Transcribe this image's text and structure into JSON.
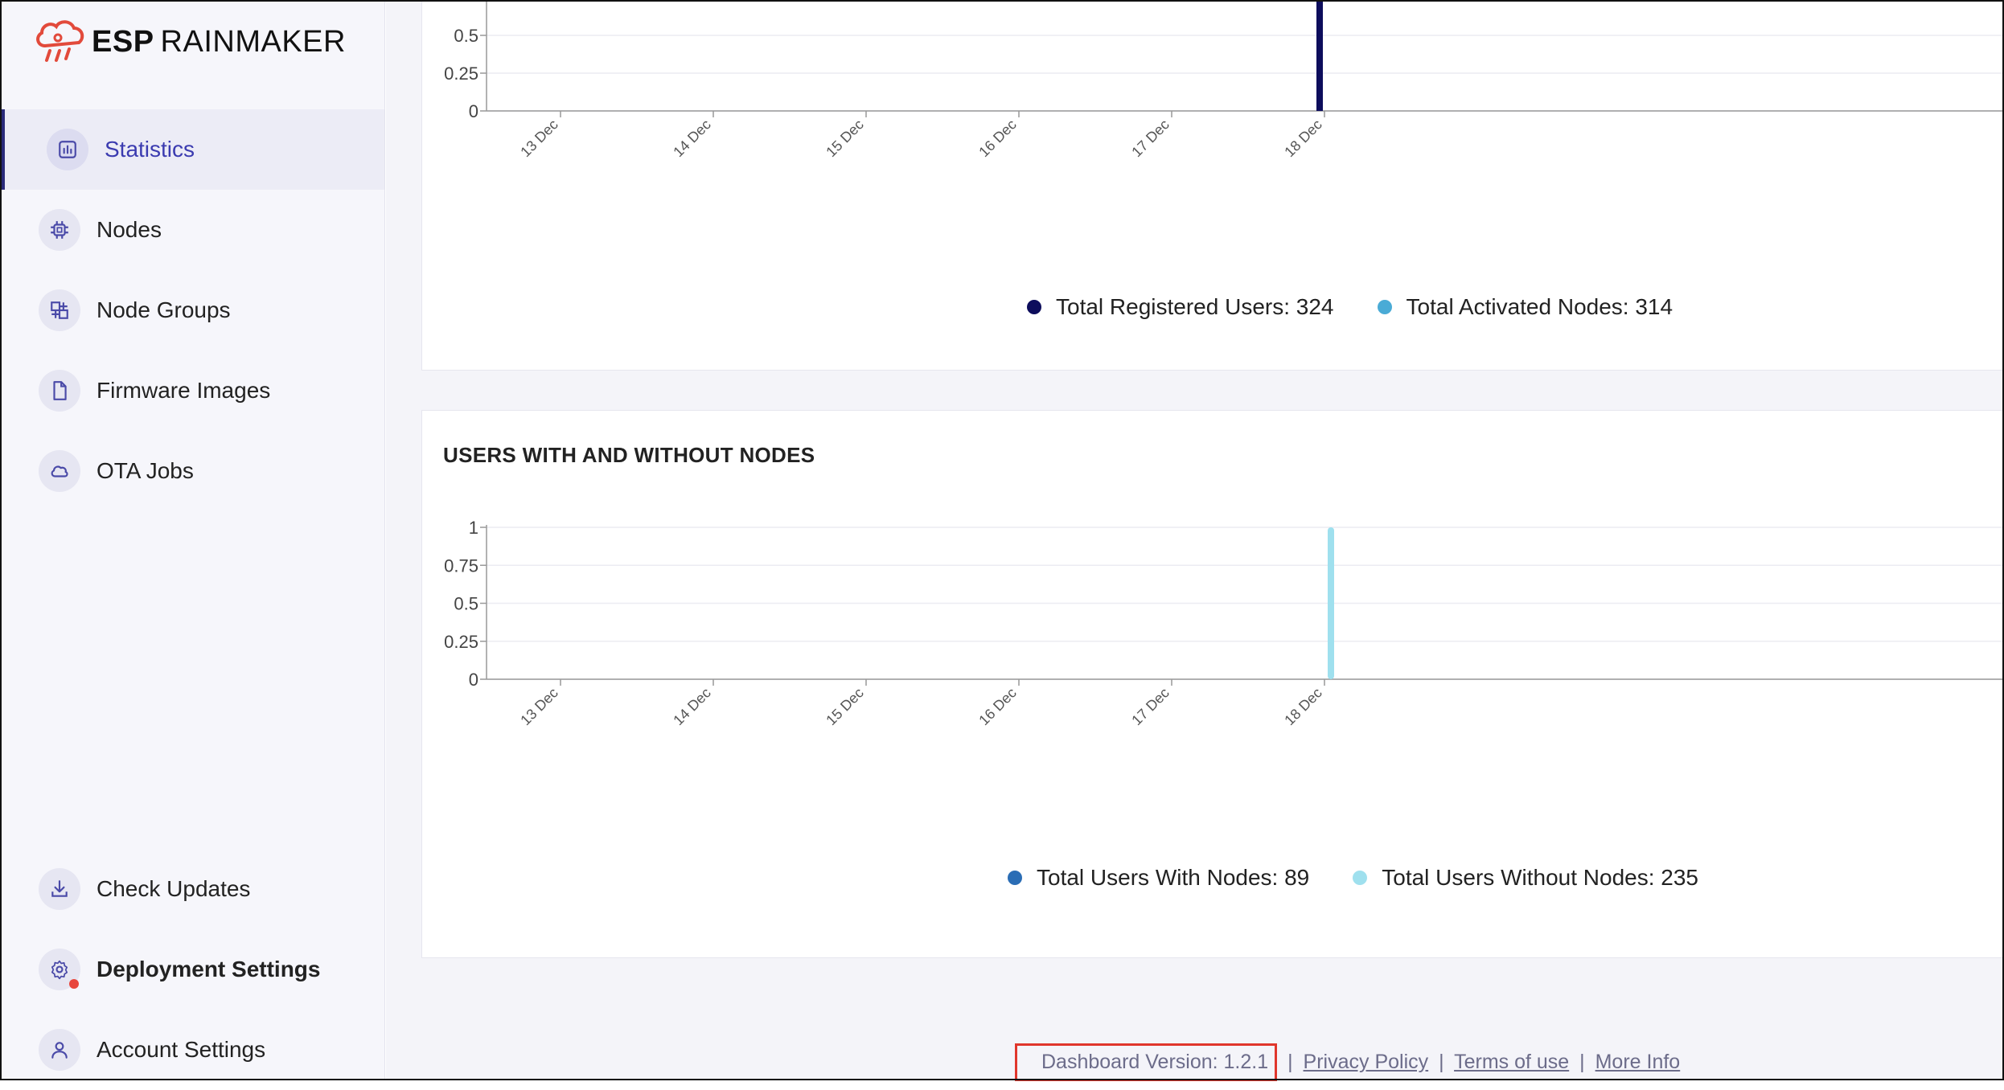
{
  "brand": {
    "esp": "ESP",
    "rainmaker": "RAINMAKER",
    "logo_color": "#e24a3b"
  },
  "sidebar": {
    "items": [
      {
        "label": "Statistics",
        "icon": "bar-chart-icon",
        "active": true
      },
      {
        "label": "Nodes",
        "icon": "chip-icon"
      },
      {
        "label": "Node Groups",
        "icon": "node-groups-icon"
      },
      {
        "label": "Firmware Images",
        "icon": "file-icon"
      },
      {
        "label": "OTA Jobs",
        "icon": "cloud-icon"
      }
    ],
    "bottom_items": [
      {
        "label": "Check Updates",
        "icon": "download-icon"
      },
      {
        "label": "Deployment Settings",
        "icon": "gear-icon",
        "badge": "red-dot"
      },
      {
        "label": "Account Settings",
        "icon": "user-icon"
      }
    ]
  },
  "chart_data": [
    {
      "type": "bar",
      "title": "",
      "x": [
        "13 Dec",
        "14 Dec",
        "15 Dec",
        "16 Dec",
        "17 Dec",
        "18 Dec"
      ],
      "y_ticks": [
        "0",
        "0.25",
        "0.5"
      ],
      "series": [
        {
          "name": "Total Registered Users: 324",
          "color": "#0d0d5c",
          "values": [
            0,
            0,
            0,
            0,
            0,
            1
          ]
        },
        {
          "name": "Total Activated Nodes: 314",
          "color": "#4aabd6",
          "values": [
            0,
            0,
            0,
            0,
            0,
            0
          ]
        }
      ]
    },
    {
      "type": "bar",
      "title": "USERS WITH AND WITHOUT NODES",
      "x": [
        "13 Dec",
        "14 Dec",
        "15 Dec",
        "16 Dec",
        "17 Dec",
        "18 Dec"
      ],
      "y_ticks": [
        "0",
        "0.25",
        "0.5",
        "0.75",
        "1"
      ],
      "ylim": [
        0,
        1
      ],
      "series": [
        {
          "name": "Total Users With Nodes: 89",
          "color": "#2a6db5",
          "values": [
            0,
            0,
            0,
            0,
            0,
            0
          ]
        },
        {
          "name": "Total Users Without Nodes: 235",
          "color": "#9fe0ee",
          "values": [
            0,
            0,
            0,
            0,
            0,
            1
          ]
        }
      ]
    }
  ],
  "footer": {
    "version": "Dashboard Version: 1.2.1",
    "privacy": "Privacy Policy",
    "terms": "Terms of use",
    "more": "More Info",
    "separator": "|"
  }
}
